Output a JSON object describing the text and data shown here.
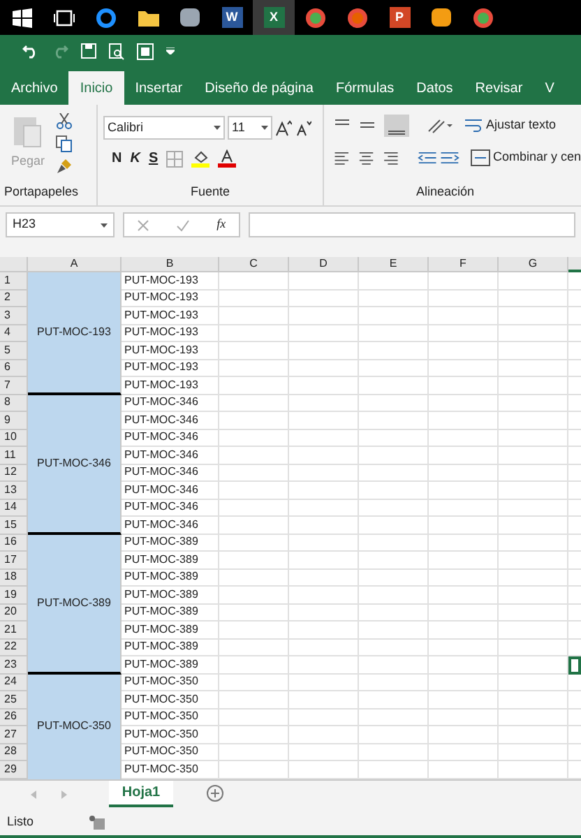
{
  "taskbar": {
    "apps": [
      {
        "kind": "start",
        "selected": false
      },
      {
        "kind": "taskview",
        "selected": false
      },
      {
        "kind": "edge",
        "selected": false
      },
      {
        "kind": "folder",
        "selected": false
      },
      {
        "kind": "generic",
        "selected": false
      },
      {
        "kind": "word",
        "glyph": "W",
        "selected": false
      },
      {
        "kind": "excel",
        "glyph": "X",
        "selected": true
      },
      {
        "kind": "chrome",
        "selected": false
      },
      {
        "kind": "firefox",
        "selected": false
      },
      {
        "kind": "powerpoint",
        "glyph": "P",
        "selected": false
      },
      {
        "kind": "player",
        "selected": false
      },
      {
        "kind": "chrome",
        "selected": false
      }
    ]
  },
  "ribbon_tabs": [
    {
      "label": "Archivo",
      "selected": false
    },
    {
      "label": "Inicio",
      "selected": true
    },
    {
      "label": "Insertar",
      "selected": false
    },
    {
      "label": "Diseño de página",
      "selected": false
    },
    {
      "label": "Fórmulas",
      "selected": false
    },
    {
      "label": "Datos",
      "selected": false
    },
    {
      "label": "Revisar",
      "selected": false
    },
    {
      "label": "V",
      "selected": false
    }
  ],
  "ribbon": {
    "paste": "Pegar",
    "clipboard_group": "Portapapeles",
    "font": "Calibri",
    "font_size": "11",
    "bold": "N",
    "italic": "K",
    "underline": "S",
    "font_group": "Fuente",
    "wrap_text": "Ajustar texto",
    "merge": "Combinar y cen",
    "alignment_group": "Alineación"
  },
  "formula_bar": {
    "name_box": "H23",
    "fx": "fx"
  },
  "columns": [
    "A",
    "B",
    "C",
    "D",
    "E",
    "F",
    "G"
  ],
  "groups": [
    {
      "a": "PUT-MOC-193",
      "rows": [
        {
          "n": "1",
          "b": "PUT-MOC-193",
          "selected": false
        },
        {
          "n": "2",
          "b": "PUT-MOC-193",
          "selected": false
        },
        {
          "n": "3",
          "b": "PUT-MOC-193",
          "selected": false
        },
        {
          "n": "4",
          "b": "PUT-MOC-193",
          "selected": false
        },
        {
          "n": "5",
          "b": "PUT-MOC-193",
          "selected": false
        },
        {
          "n": "6",
          "b": "PUT-MOC-193",
          "selected": false
        },
        {
          "n": "7",
          "b": "PUT-MOC-193",
          "selected": false
        }
      ]
    },
    {
      "a": "PUT-MOC-346",
      "rows": [
        {
          "n": "8",
          "b": "PUT-MOC-346",
          "selected": false
        },
        {
          "n": "9",
          "b": "PUT-MOC-346",
          "selected": false
        },
        {
          "n": "10",
          "b": "PUT-MOC-346",
          "selected": false
        },
        {
          "n": "11",
          "b": "PUT-MOC-346",
          "selected": false
        },
        {
          "n": "12",
          "b": "PUT-MOC-346",
          "selected": false
        },
        {
          "n": "13",
          "b": "PUT-MOC-346",
          "selected": false
        },
        {
          "n": "14",
          "b": "PUT-MOC-346",
          "selected": false
        },
        {
          "n": "15",
          "b": "PUT-MOC-346",
          "selected": false
        }
      ]
    },
    {
      "a": "PUT-MOC-389",
      "rows": [
        {
          "n": "16",
          "b": "PUT-MOC-389",
          "selected": false
        },
        {
          "n": "17",
          "b": "PUT-MOC-389",
          "selected": false
        },
        {
          "n": "18",
          "b": "PUT-MOC-389",
          "selected": false
        },
        {
          "n": "19",
          "b": "PUT-MOC-389",
          "selected": false
        },
        {
          "n": "20",
          "b": "PUT-MOC-389",
          "selected": false
        },
        {
          "n": "21",
          "b": "PUT-MOC-389",
          "selected": false
        },
        {
          "n": "22",
          "b": "PUT-MOC-389",
          "selected": false
        },
        {
          "n": "23",
          "b": "PUT-MOC-389",
          "selected": true
        }
      ]
    },
    {
      "a": "PUT-MOC-350",
      "rows": [
        {
          "n": "24",
          "b": "PUT-MOC-350",
          "selected": false
        },
        {
          "n": "25",
          "b": "PUT-MOC-350",
          "selected": false
        },
        {
          "n": "26",
          "b": "PUT-MOC-350",
          "selected": false
        },
        {
          "n": "27",
          "b": "PUT-MOC-350",
          "selected": false
        },
        {
          "n": "28",
          "b": "PUT-MOC-350",
          "selected": false
        },
        {
          "n": "29",
          "b": "PUT-MOC-350",
          "selected": false
        }
      ]
    }
  ],
  "sheet_tabs": [
    {
      "label": "Hoja1",
      "selected": true
    }
  ],
  "status_bar": {
    "text": "Listo"
  }
}
